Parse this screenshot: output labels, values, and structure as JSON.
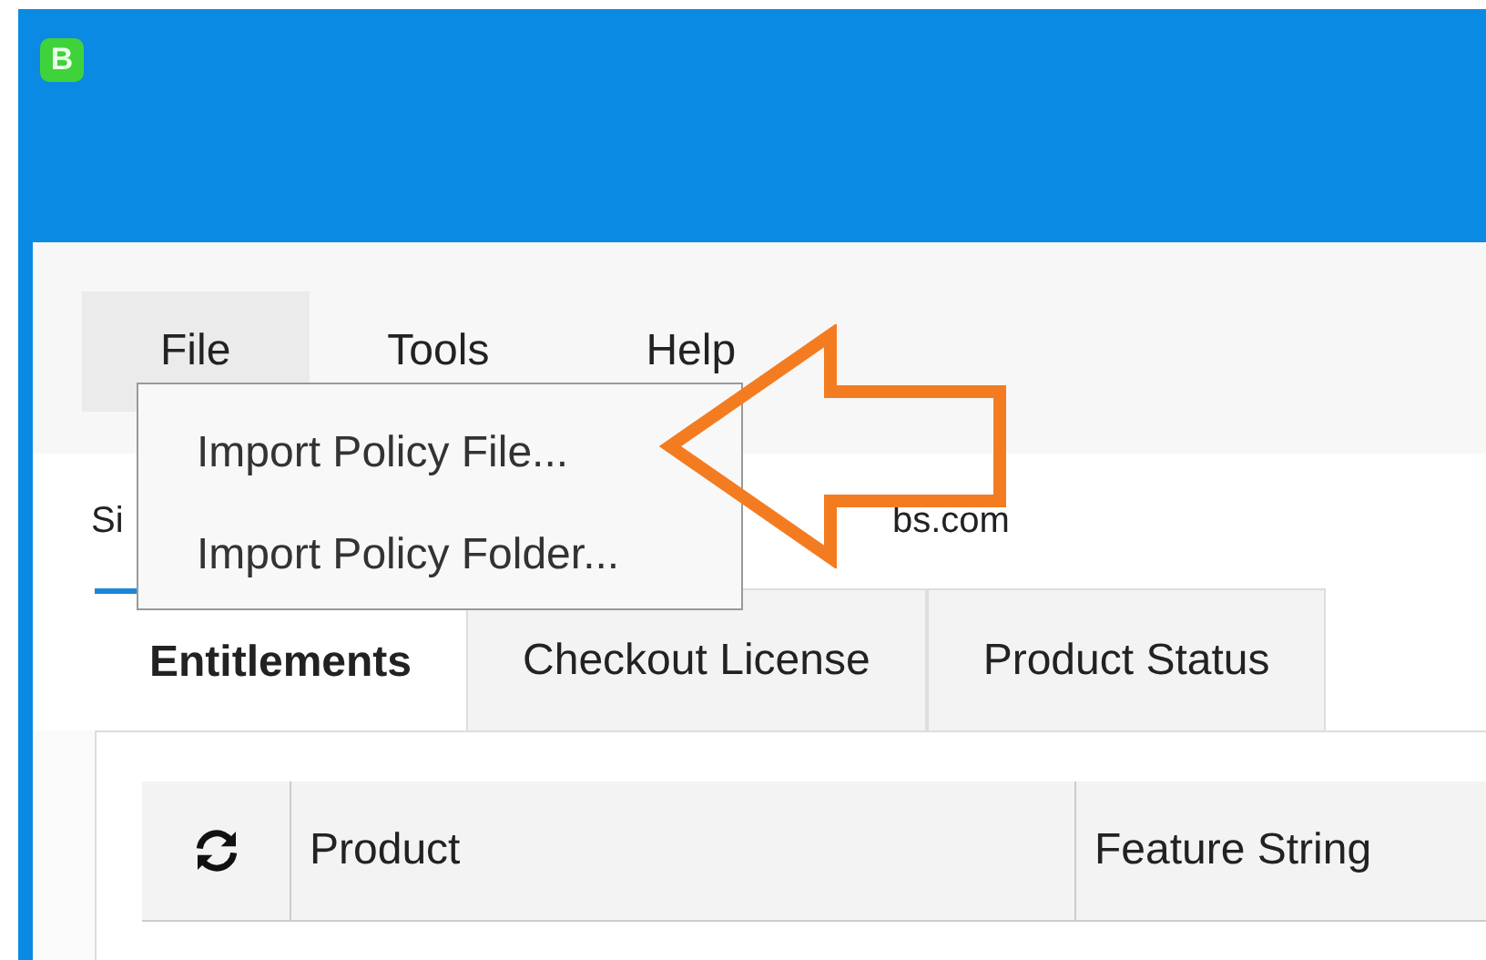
{
  "app": {
    "icon_label": "B"
  },
  "menu": [
    {
      "label": "File",
      "selected": true
    },
    {
      "label": "Tools",
      "selected": false
    },
    {
      "label": "Help",
      "selected": false
    }
  ],
  "dropdown": [
    {
      "label": "Import Policy File..."
    },
    {
      "label": "Import Policy Folder..."
    }
  ],
  "info_line": [
    "Si",
    "bs.com"
  ],
  "tabs": [
    {
      "label": "Entitlements",
      "selected": true
    },
    {
      "label": "Checkout License",
      "selected": false
    },
    {
      "label": "Product Status",
      "selected": false
    }
  ],
  "table": {
    "columns": [
      "Product",
      "Feature String"
    ]
  }
}
